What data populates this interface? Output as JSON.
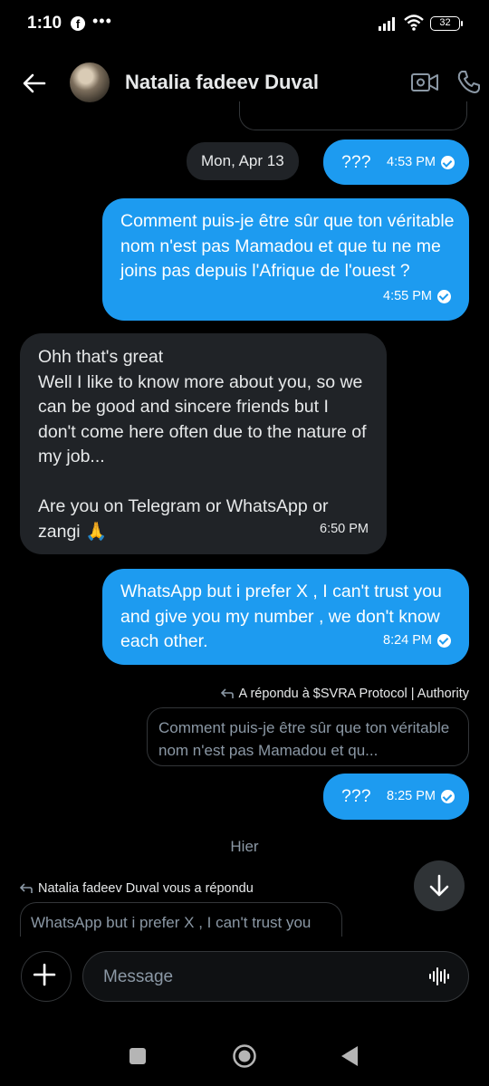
{
  "status_bar": {
    "time": "1:10",
    "dots": "•••",
    "battery": "32"
  },
  "header": {
    "title": "Natalia fadeev Duval"
  },
  "date_chip": "Mon, Apr 13",
  "messages": [
    {
      "text": "???",
      "time": "4:53 PM"
    },
    {
      "text": "Comment puis-je être sûr que ton véritable nom n'est pas Mamadou et que tu ne me joins pas depuis l'Afrique de l'ouest ?",
      "time": "4:55 PM"
    },
    {
      "text": "Ohh that's great\nWell I like to know more about you, so we can be good and sincere friends but I don't come here often due to the nature of my job...\n\nAre you on Telegram or WhatsApp or zangi 🙏",
      "time": "6:50 PM"
    },
    {
      "text": "WhatsApp but i prefer X , I can't trust you and give you my number , we don't know each other.",
      "time": "8:24 PM"
    },
    {
      "text": "???",
      "time": "8:25 PM"
    }
  ],
  "reply_1": {
    "label": "A répondu à $SVRA Protocol | Authority",
    "quote": "Comment puis-je être sûr que ton véritable nom n'est pas Mamadou et qu..."
  },
  "day_separator": "Hier",
  "reply_2": {
    "label": "Natalia fadeev Duval vous a répondu",
    "quote": "WhatsApp but i prefer X , I can't trust you"
  },
  "composer": {
    "placeholder": "Message"
  },
  "colors": {
    "sent_bubble": "#1d9bf0",
    "received_bubble": "#202327",
    "background": "#000000"
  },
  "icons": [
    "facebook-icon",
    "signal-icon",
    "wifi-icon",
    "battery-icon",
    "back-arrow-icon",
    "video-call-icon",
    "phone-icon",
    "read-check-icon",
    "reply-arrow-icon",
    "arrow-down-icon",
    "plus-icon",
    "voice-icon",
    "nav-recents-icon",
    "nav-home-icon",
    "nav-back-icon"
  ]
}
